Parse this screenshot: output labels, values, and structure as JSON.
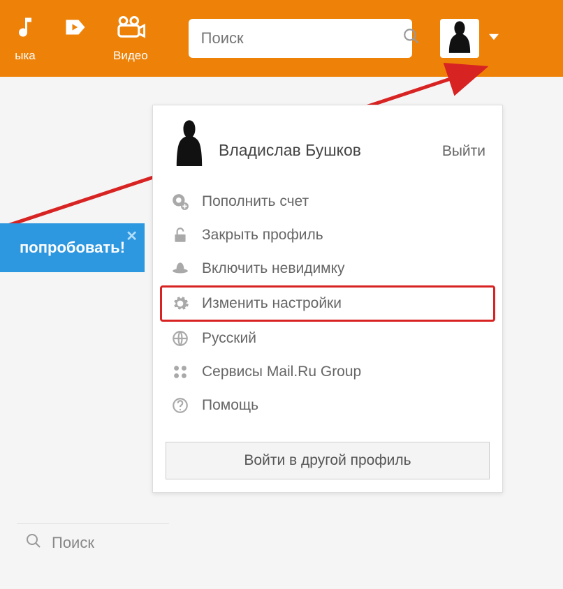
{
  "header": {
    "nav_music_label": "ыка",
    "nav_video_label": "Видео"
  },
  "search": {
    "placeholder": "Поиск"
  },
  "dropdown": {
    "user_name": "Владислав Бушков",
    "logout_label": "Выйти",
    "items": [
      {
        "label": "Пополнить счет"
      },
      {
        "label": "Закрыть профиль"
      },
      {
        "label": "Включить невидимку"
      },
      {
        "label": "Изменить настройки"
      },
      {
        "label": "Русский"
      },
      {
        "label": "Сервисы Mail.Ru Group"
      },
      {
        "label": "Помощь"
      }
    ],
    "login_other": "Войти в другой профиль"
  },
  "banner": {
    "text": "попробовать!"
  },
  "bottom_search": {
    "label": "Поиск"
  }
}
